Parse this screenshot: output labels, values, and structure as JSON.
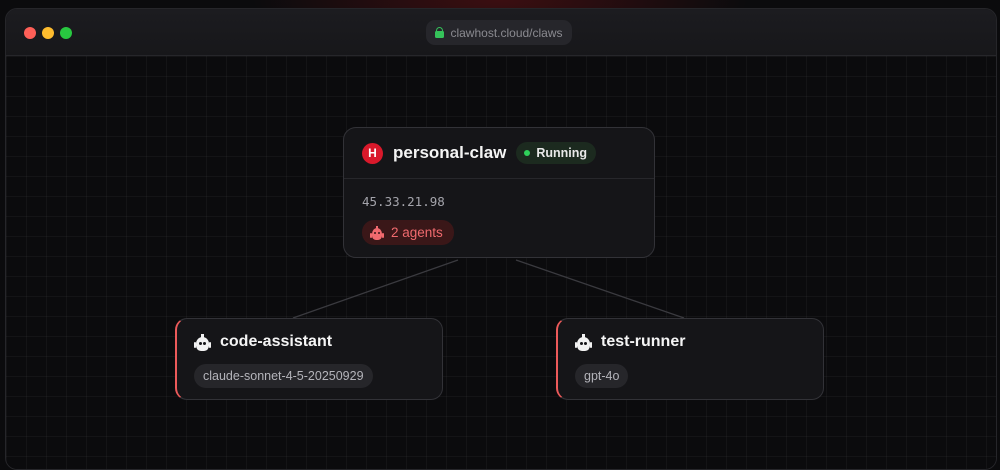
{
  "browser": {
    "url": "clawhost.cloud/claws"
  },
  "server": {
    "brand_letter": "H",
    "name": "personal-claw",
    "status": "Running",
    "ip": "45.33.21.98",
    "agents_label": "2 agents"
  },
  "agents": [
    {
      "name": "code-assistant",
      "model": "claude-sonnet-4-5-20250929"
    },
    {
      "name": "test-runner",
      "model": "gpt-4o"
    }
  ],
  "colors": {
    "accent": "#ec5a5a",
    "brand": "#d9192b",
    "status_running": "#2fd05a",
    "window_close": "#fe5f57",
    "window_minimize": "#febc2e",
    "window_maximize": "#28c840"
  },
  "icons": {
    "window_controls": [
      "close-dot",
      "minimize-dot",
      "maximize-dot"
    ],
    "url_secure": "lock-icon",
    "server": "brand-h-icon",
    "agents": "robot-icon"
  }
}
